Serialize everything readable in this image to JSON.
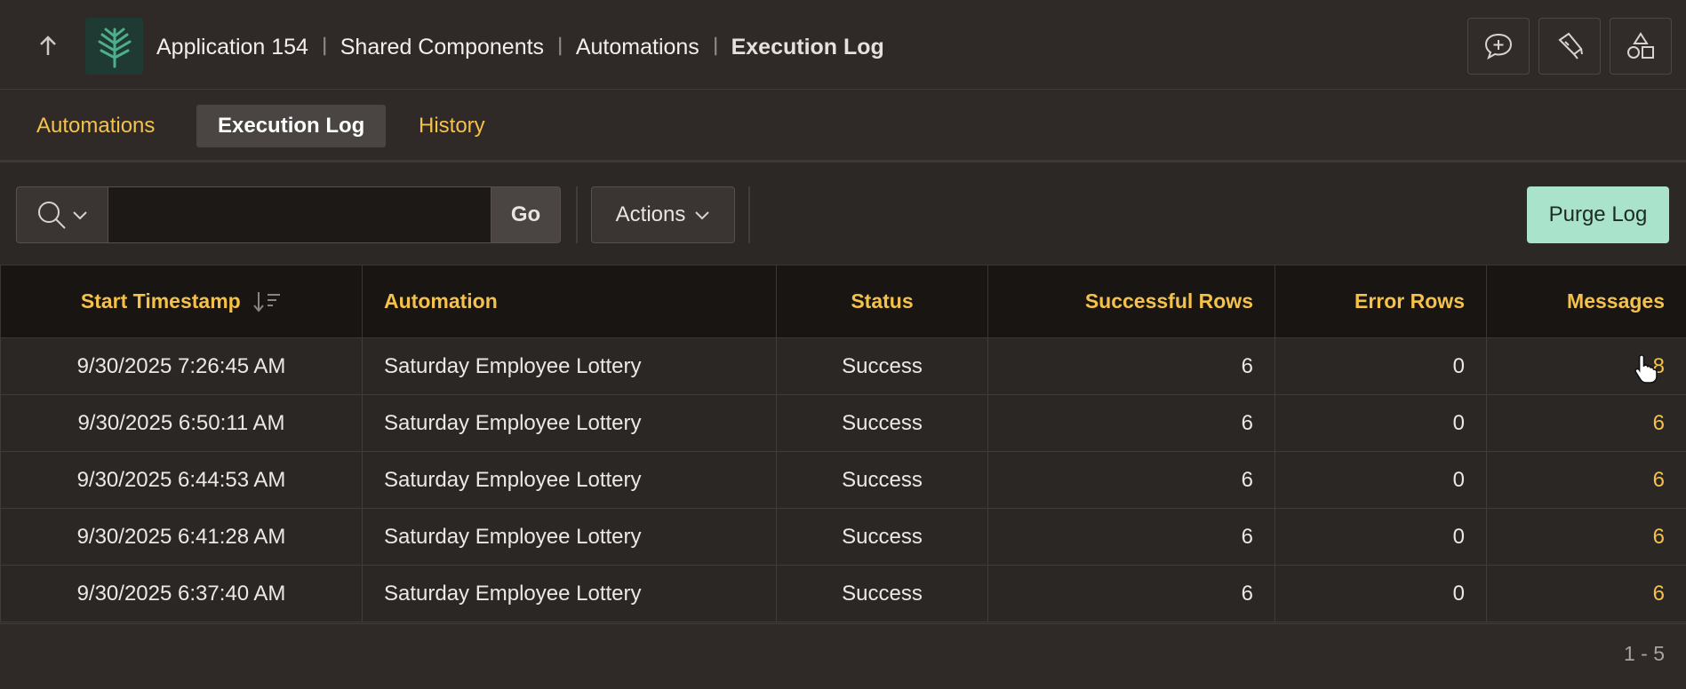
{
  "header": {
    "breadcrumb": [
      "Application 154",
      "Shared Components",
      "Automations",
      "Execution Log"
    ],
    "icons": [
      "arrow-up-icon",
      "app-logo",
      "feedback-icon",
      "flashlight-icon",
      "shapes-icon"
    ]
  },
  "tabs": [
    {
      "label": "Automations",
      "active": false
    },
    {
      "label": "Execution Log",
      "active": true
    },
    {
      "label": "History",
      "active": false
    }
  ],
  "toolbar": {
    "search_value": "",
    "go_label": "Go",
    "actions_label": "Actions",
    "purge_label": "Purge Log"
  },
  "table": {
    "columns": [
      "Start Timestamp",
      "Automation",
      "Status",
      "Successful Rows",
      "Error Rows",
      "Messages"
    ],
    "rows": [
      {
        "start": "9/30/2025 7:26:45 AM",
        "automation": "Saturday Employee Lottery",
        "status": "Success",
        "successful": "6",
        "errors": "0",
        "messages": "8"
      },
      {
        "start": "9/30/2025 6:50:11 AM",
        "automation": "Saturday Employee Lottery",
        "status": "Success",
        "successful": "6",
        "errors": "0",
        "messages": "6"
      },
      {
        "start": "9/30/2025 6:44:53 AM",
        "automation": "Saturday Employee Lottery",
        "status": "Success",
        "successful": "6",
        "errors": "0",
        "messages": "6"
      },
      {
        "start": "9/30/2025 6:41:28 AM",
        "automation": "Saturday Employee Lottery",
        "status": "Success",
        "successful": "6",
        "errors": "0",
        "messages": "6"
      },
      {
        "start": "9/30/2025 6:37:40 AM",
        "automation": "Saturday Employee Lottery",
        "status": "Success",
        "successful": "6",
        "errors": "0",
        "messages": "6"
      }
    ]
  },
  "pagination": "1 - 5",
  "colors": {
    "accent": "#f4c24a",
    "purge_button": "#a9e3cb",
    "background": "#2c2826"
  }
}
